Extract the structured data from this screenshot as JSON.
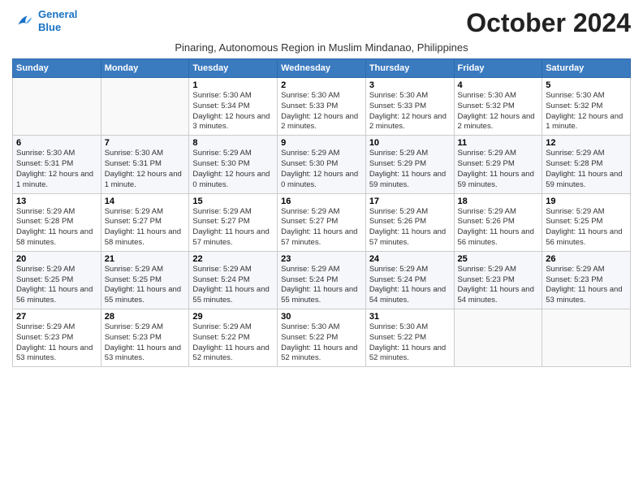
{
  "header": {
    "logo_line1": "General",
    "logo_line2": "Blue",
    "month": "October 2024",
    "subtitle": "Pinaring, Autonomous Region in Muslim Mindanao, Philippines"
  },
  "days_of_week": [
    "Sunday",
    "Monday",
    "Tuesday",
    "Wednesday",
    "Thursday",
    "Friday",
    "Saturday"
  ],
  "weeks": [
    [
      {
        "day": "",
        "info": ""
      },
      {
        "day": "",
        "info": ""
      },
      {
        "day": "1",
        "info": "Sunrise: 5:30 AM\nSunset: 5:34 PM\nDaylight: 12 hours and 3 minutes."
      },
      {
        "day": "2",
        "info": "Sunrise: 5:30 AM\nSunset: 5:33 PM\nDaylight: 12 hours and 2 minutes."
      },
      {
        "day": "3",
        "info": "Sunrise: 5:30 AM\nSunset: 5:33 PM\nDaylight: 12 hours and 2 minutes."
      },
      {
        "day": "4",
        "info": "Sunrise: 5:30 AM\nSunset: 5:32 PM\nDaylight: 12 hours and 2 minutes."
      },
      {
        "day": "5",
        "info": "Sunrise: 5:30 AM\nSunset: 5:32 PM\nDaylight: 12 hours and 1 minute."
      }
    ],
    [
      {
        "day": "6",
        "info": "Sunrise: 5:30 AM\nSunset: 5:31 PM\nDaylight: 12 hours and 1 minute."
      },
      {
        "day": "7",
        "info": "Sunrise: 5:30 AM\nSunset: 5:31 PM\nDaylight: 12 hours and 1 minute."
      },
      {
        "day": "8",
        "info": "Sunrise: 5:29 AM\nSunset: 5:30 PM\nDaylight: 12 hours and 0 minutes."
      },
      {
        "day": "9",
        "info": "Sunrise: 5:29 AM\nSunset: 5:30 PM\nDaylight: 12 hours and 0 minutes."
      },
      {
        "day": "10",
        "info": "Sunrise: 5:29 AM\nSunset: 5:29 PM\nDaylight: 11 hours and 59 minutes."
      },
      {
        "day": "11",
        "info": "Sunrise: 5:29 AM\nSunset: 5:29 PM\nDaylight: 11 hours and 59 minutes."
      },
      {
        "day": "12",
        "info": "Sunrise: 5:29 AM\nSunset: 5:28 PM\nDaylight: 11 hours and 59 minutes."
      }
    ],
    [
      {
        "day": "13",
        "info": "Sunrise: 5:29 AM\nSunset: 5:28 PM\nDaylight: 11 hours and 58 minutes."
      },
      {
        "day": "14",
        "info": "Sunrise: 5:29 AM\nSunset: 5:27 PM\nDaylight: 11 hours and 58 minutes."
      },
      {
        "day": "15",
        "info": "Sunrise: 5:29 AM\nSunset: 5:27 PM\nDaylight: 11 hours and 57 minutes."
      },
      {
        "day": "16",
        "info": "Sunrise: 5:29 AM\nSunset: 5:27 PM\nDaylight: 11 hours and 57 minutes."
      },
      {
        "day": "17",
        "info": "Sunrise: 5:29 AM\nSunset: 5:26 PM\nDaylight: 11 hours and 57 minutes."
      },
      {
        "day": "18",
        "info": "Sunrise: 5:29 AM\nSunset: 5:26 PM\nDaylight: 11 hours and 56 minutes."
      },
      {
        "day": "19",
        "info": "Sunrise: 5:29 AM\nSunset: 5:25 PM\nDaylight: 11 hours and 56 minutes."
      }
    ],
    [
      {
        "day": "20",
        "info": "Sunrise: 5:29 AM\nSunset: 5:25 PM\nDaylight: 11 hours and 56 minutes."
      },
      {
        "day": "21",
        "info": "Sunrise: 5:29 AM\nSunset: 5:25 PM\nDaylight: 11 hours and 55 minutes."
      },
      {
        "day": "22",
        "info": "Sunrise: 5:29 AM\nSunset: 5:24 PM\nDaylight: 11 hours and 55 minutes."
      },
      {
        "day": "23",
        "info": "Sunrise: 5:29 AM\nSunset: 5:24 PM\nDaylight: 11 hours and 55 minutes."
      },
      {
        "day": "24",
        "info": "Sunrise: 5:29 AM\nSunset: 5:24 PM\nDaylight: 11 hours and 54 minutes."
      },
      {
        "day": "25",
        "info": "Sunrise: 5:29 AM\nSunset: 5:23 PM\nDaylight: 11 hours and 54 minutes."
      },
      {
        "day": "26",
        "info": "Sunrise: 5:29 AM\nSunset: 5:23 PM\nDaylight: 11 hours and 53 minutes."
      }
    ],
    [
      {
        "day": "27",
        "info": "Sunrise: 5:29 AM\nSunset: 5:23 PM\nDaylight: 11 hours and 53 minutes."
      },
      {
        "day": "28",
        "info": "Sunrise: 5:29 AM\nSunset: 5:23 PM\nDaylight: 11 hours and 53 minutes."
      },
      {
        "day": "29",
        "info": "Sunrise: 5:29 AM\nSunset: 5:22 PM\nDaylight: 11 hours and 52 minutes."
      },
      {
        "day": "30",
        "info": "Sunrise: 5:30 AM\nSunset: 5:22 PM\nDaylight: 11 hours and 52 minutes."
      },
      {
        "day": "31",
        "info": "Sunrise: 5:30 AM\nSunset: 5:22 PM\nDaylight: 11 hours and 52 minutes."
      },
      {
        "day": "",
        "info": ""
      },
      {
        "day": "",
        "info": ""
      }
    ]
  ]
}
